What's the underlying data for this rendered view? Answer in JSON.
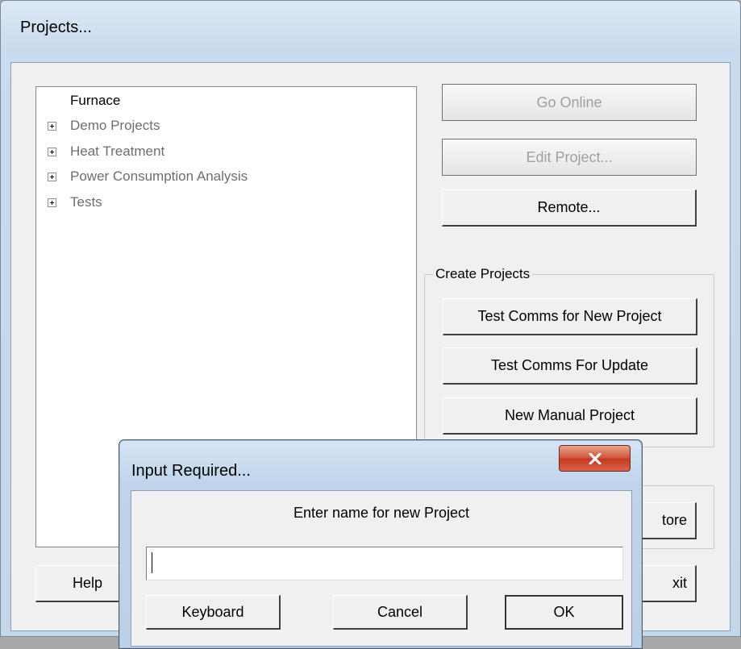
{
  "main_window": {
    "title": "Projects...",
    "tree": {
      "root": "Furnace",
      "items": [
        {
          "label": "Demo Projects",
          "icon": "plus-expander-icon"
        },
        {
          "label": "Heat Treatment",
          "icon": "plus-expander-icon"
        },
        {
          "label": "Power Consumption Analysis",
          "icon": "plus-expander-icon"
        },
        {
          "label": "Tests",
          "icon": "plus-expander-icon"
        }
      ]
    },
    "buttons": {
      "go_online": "Go Online",
      "edit_project": "Edit Project...",
      "remote": "Remote...",
      "restore_partial": "tore",
      "help": "Help",
      "exit_partial": "xit"
    },
    "create_projects": {
      "label": "Create Projects",
      "test_comms_new": "Test Comms for New Project",
      "test_comms_update": "Test Comms For Update",
      "new_manual": "New Manual Project"
    }
  },
  "dialog": {
    "title": "Input Required...",
    "prompt": "Enter name for new Project",
    "input_value": "",
    "buttons": {
      "keyboard": "Keyboard",
      "cancel": "Cancel",
      "ok": "OK"
    },
    "close_icon": "close-x-icon"
  },
  "colors": {
    "disabled_text": "#a0a0a0",
    "close_button": "#c9452d",
    "window_frame": "#c4d6ea"
  }
}
